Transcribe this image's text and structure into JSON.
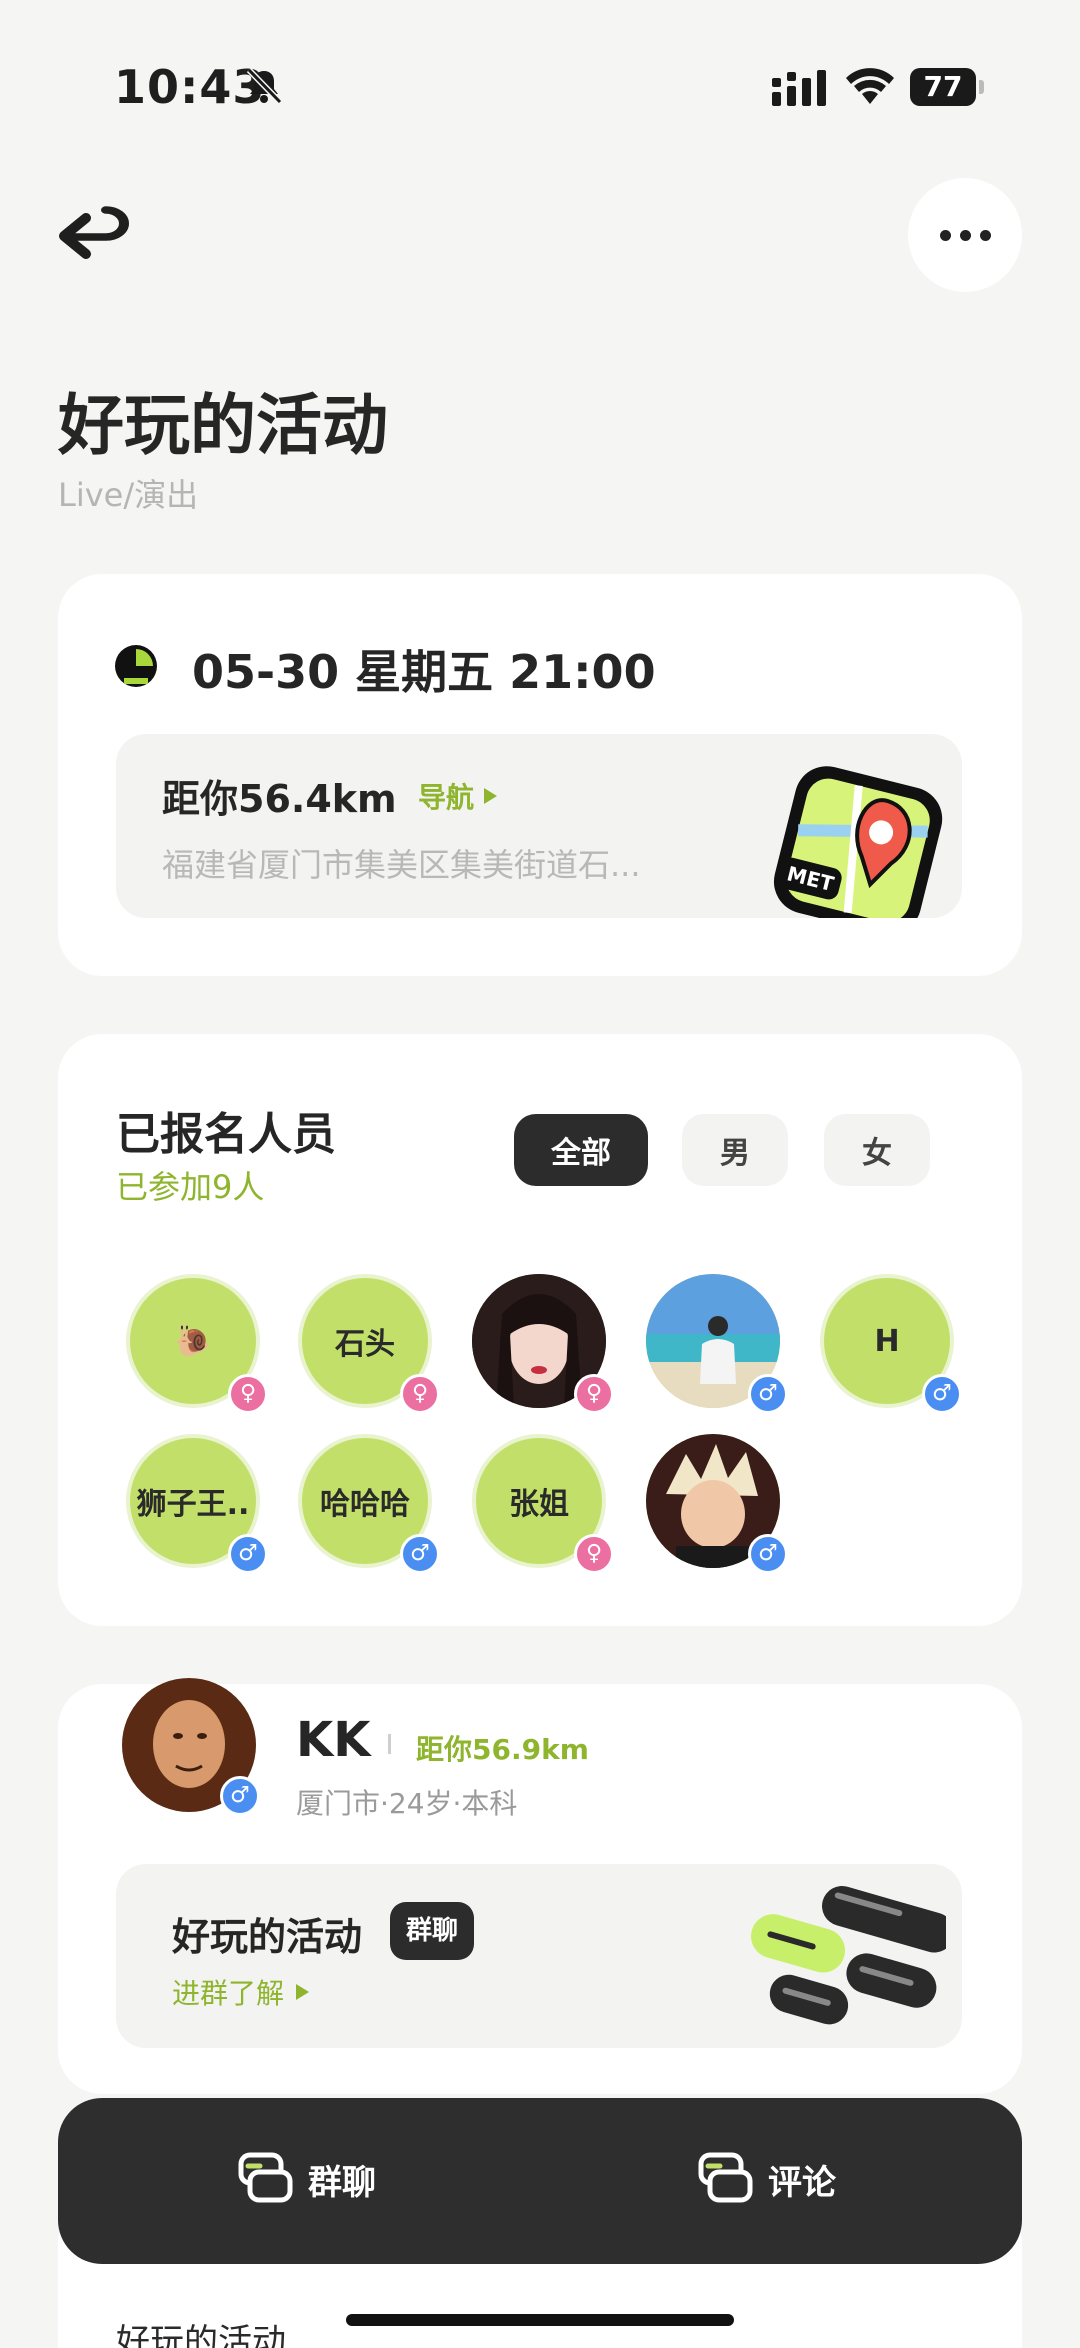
{
  "status_bar": {
    "time": "10:43",
    "battery": "77"
  },
  "header": {
    "back_icon": "back-arrow-icon",
    "more_icon": "more-dots-icon"
  },
  "page": {
    "title": "好玩的活动",
    "subtitle": "Live/演出"
  },
  "event": {
    "datetime": "05-30 星期五 21:00",
    "distance": "距你56.4km",
    "nav_label": "导航",
    "address": "福建省厦门市集美区集美街道石..."
  },
  "attendees": {
    "title": "已报名人员",
    "count": "已参加9人",
    "filters": [
      "全部",
      "男",
      "女"
    ],
    "people": [
      {
        "label": "🐌",
        "gender": "female",
        "gender_symbol": "♀"
      },
      {
        "label": "石头",
        "gender": "female",
        "gender_symbol": "♀"
      },
      {
        "label": "",
        "gender": "female",
        "gender_symbol": "♀"
      },
      {
        "label": "",
        "gender": "male",
        "gender_symbol": "♂"
      },
      {
        "label": "H",
        "gender": "male",
        "gender_symbol": "♂"
      },
      {
        "label": "狮子王..",
        "gender": "male",
        "gender_symbol": "♂"
      },
      {
        "label": "哈哈哈",
        "gender": "male",
        "gender_symbol": "♂"
      },
      {
        "label": "张姐",
        "gender": "female",
        "gender_symbol": "♀"
      },
      {
        "label": "",
        "gender": "male",
        "gender_symbol": "♂"
      }
    ]
  },
  "organizer": {
    "name": "KK",
    "distance": "距你56.9km",
    "info": "厦门市·24岁·本科",
    "gender_symbol": "♂",
    "group_name": "好玩的活动",
    "group_tag": "群聊",
    "group_join": "进群了解"
  },
  "bottom_preview": "好玩的活动",
  "actions": {
    "chat": "群聊",
    "comment": "评论"
  },
  "colors": {
    "accent_green": "#8fb52e",
    "avatar_green": "#c2e069",
    "male_blue": "#4b8ef1",
    "female_pink": "#ec6fa1",
    "dark": "#2e2e2e"
  }
}
